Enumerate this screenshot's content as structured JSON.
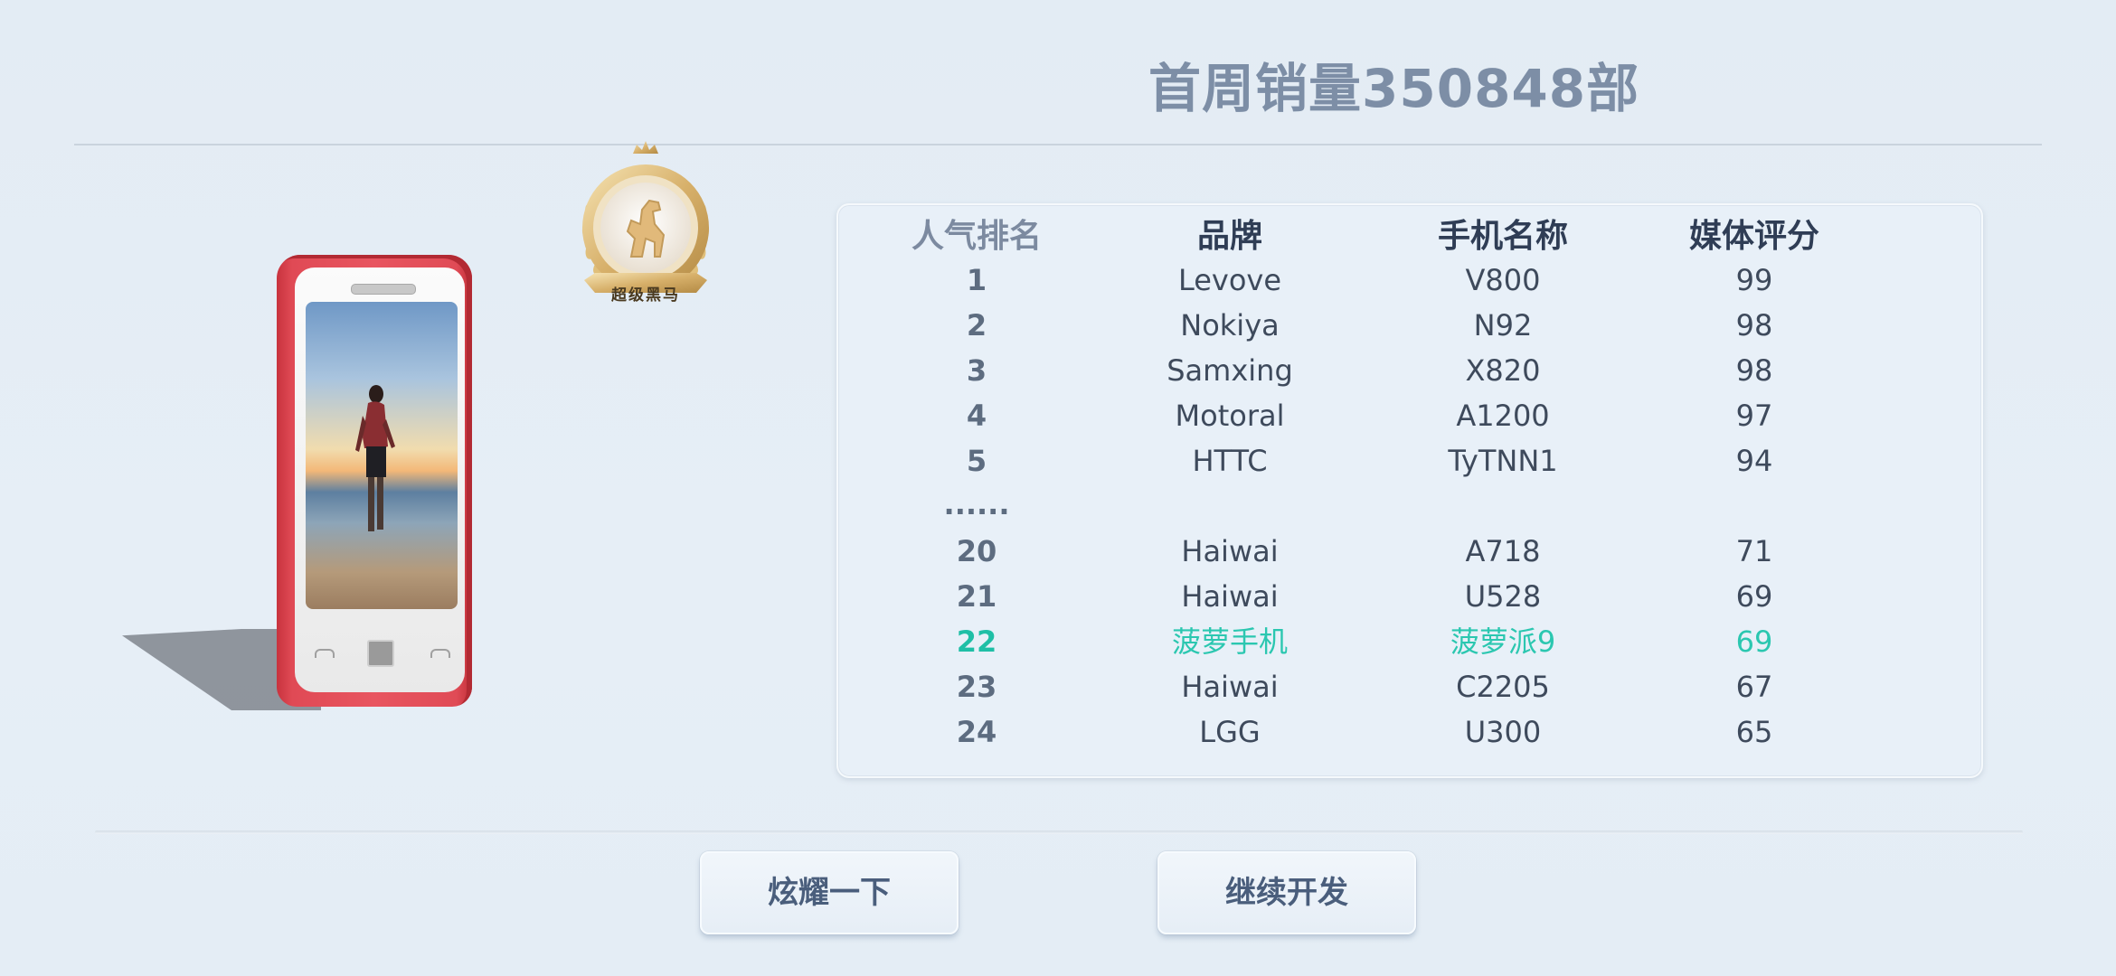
{
  "header": {
    "title": "首周销量350848部"
  },
  "badge": {
    "label": "超级黑马"
  },
  "phone": {
    "screen_image": "beach-sunset-photo"
  },
  "table": {
    "columns": [
      "人气排名",
      "品牌",
      "手机名称",
      "媒体评分"
    ],
    "rows": [
      {
        "rank": "1",
        "brand": "Levove",
        "model": "V800",
        "score": "99"
      },
      {
        "rank": "2",
        "brand": "Nokiya",
        "model": "N92",
        "score": "98"
      },
      {
        "rank": "3",
        "brand": "Samxing",
        "model": "X820",
        "score": "98"
      },
      {
        "rank": "4",
        "brand": "Motoral",
        "model": "A1200",
        "score": "97"
      },
      {
        "rank": "5",
        "brand": "HTTC",
        "model": "TyTNN1",
        "score": "94"
      }
    ],
    "ellipsis": "......",
    "rows_after": [
      {
        "rank": "20",
        "brand": "Haiwai",
        "model": "A718",
        "score": "71"
      },
      {
        "rank": "21",
        "brand": "Haiwai",
        "model": "U528",
        "score": "69"
      },
      {
        "rank": "22",
        "brand": "菠萝手机",
        "model": "菠萝派9",
        "score": "69"
      },
      {
        "rank": "23",
        "brand": "Haiwai",
        "model": "C2205",
        "score": "67"
      },
      {
        "rank": "24",
        "brand": "LGG",
        "model": "U300",
        "score": "65"
      }
    ],
    "highlight_color": "#2bc7b0"
  },
  "buttons": {
    "show_off": "炫耀一下",
    "continue": "继续开发"
  }
}
